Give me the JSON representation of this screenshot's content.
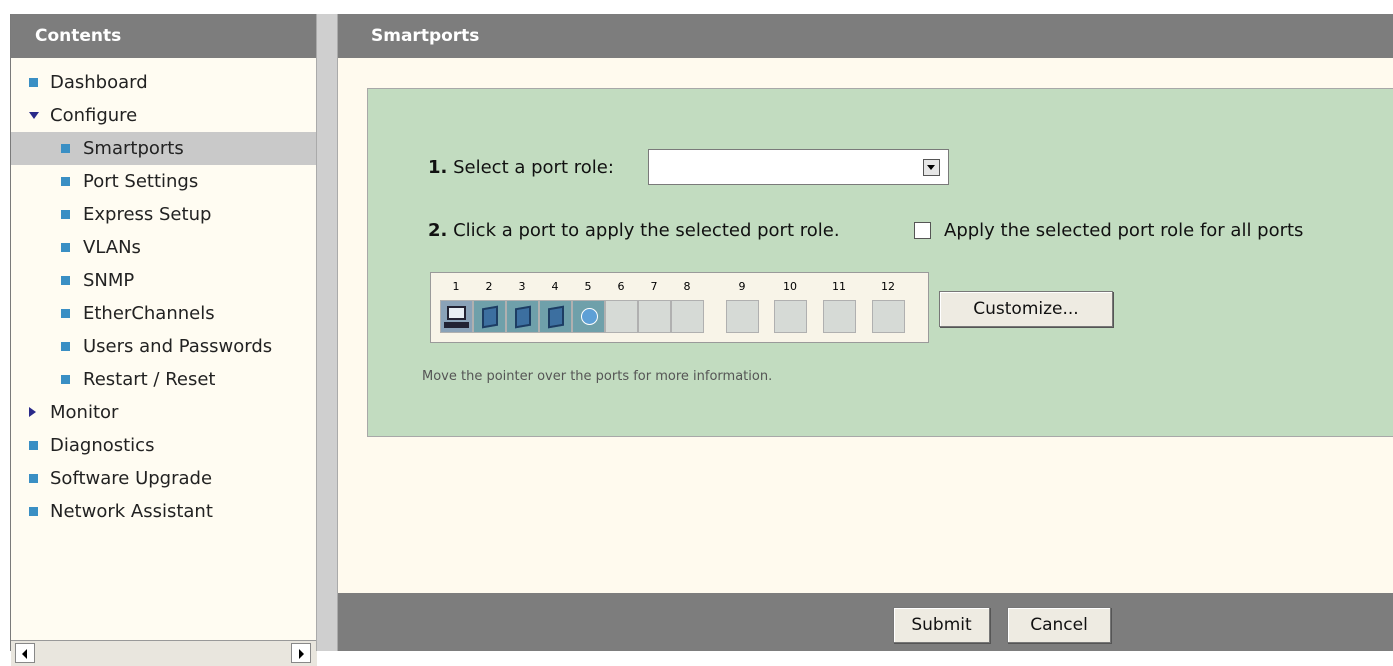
{
  "contents_panel": {
    "title": "Contents",
    "items": [
      {
        "label": "Dashboard"
      },
      {
        "label": "Configure"
      },
      {
        "label": "Smartports"
      },
      {
        "label": "Port Settings"
      },
      {
        "label": "Express Setup"
      },
      {
        "label": "VLANs"
      },
      {
        "label": "SNMP"
      },
      {
        "label": "EtherChannels"
      },
      {
        "label": "Users and Passwords"
      },
      {
        "label": "Restart / Reset"
      },
      {
        "label": "Monitor"
      },
      {
        "label": "Diagnostics"
      },
      {
        "label": "Software Upgrade"
      },
      {
        "label": "Network Assistant"
      }
    ]
  },
  "main": {
    "title": "Smartports",
    "step1": {
      "number": "1.",
      "text": "Select a port role:",
      "selected_value": ""
    },
    "step2": {
      "number": "2.",
      "text": "Click a port to apply the selected port role.",
      "checkbox_label": "Apply the selected port role for all ports"
    },
    "ports": {
      "numbers": [
        "1",
        "2",
        "3",
        "4",
        "5",
        "6",
        "7",
        "8",
        "9",
        "10",
        "11",
        "12"
      ],
      "icons": [
        "desktop-icon",
        "switch-icon",
        "switch-icon",
        "switch-icon",
        "globe-icon",
        "empty",
        "empty",
        "empty",
        "empty",
        "empty",
        "empty",
        "empty"
      ]
    },
    "customize_label": "Customize...",
    "hint": "Move the pointer over the ports for more information."
  },
  "footer": {
    "submit_label": "Submit",
    "cancel_label": "Cancel"
  }
}
